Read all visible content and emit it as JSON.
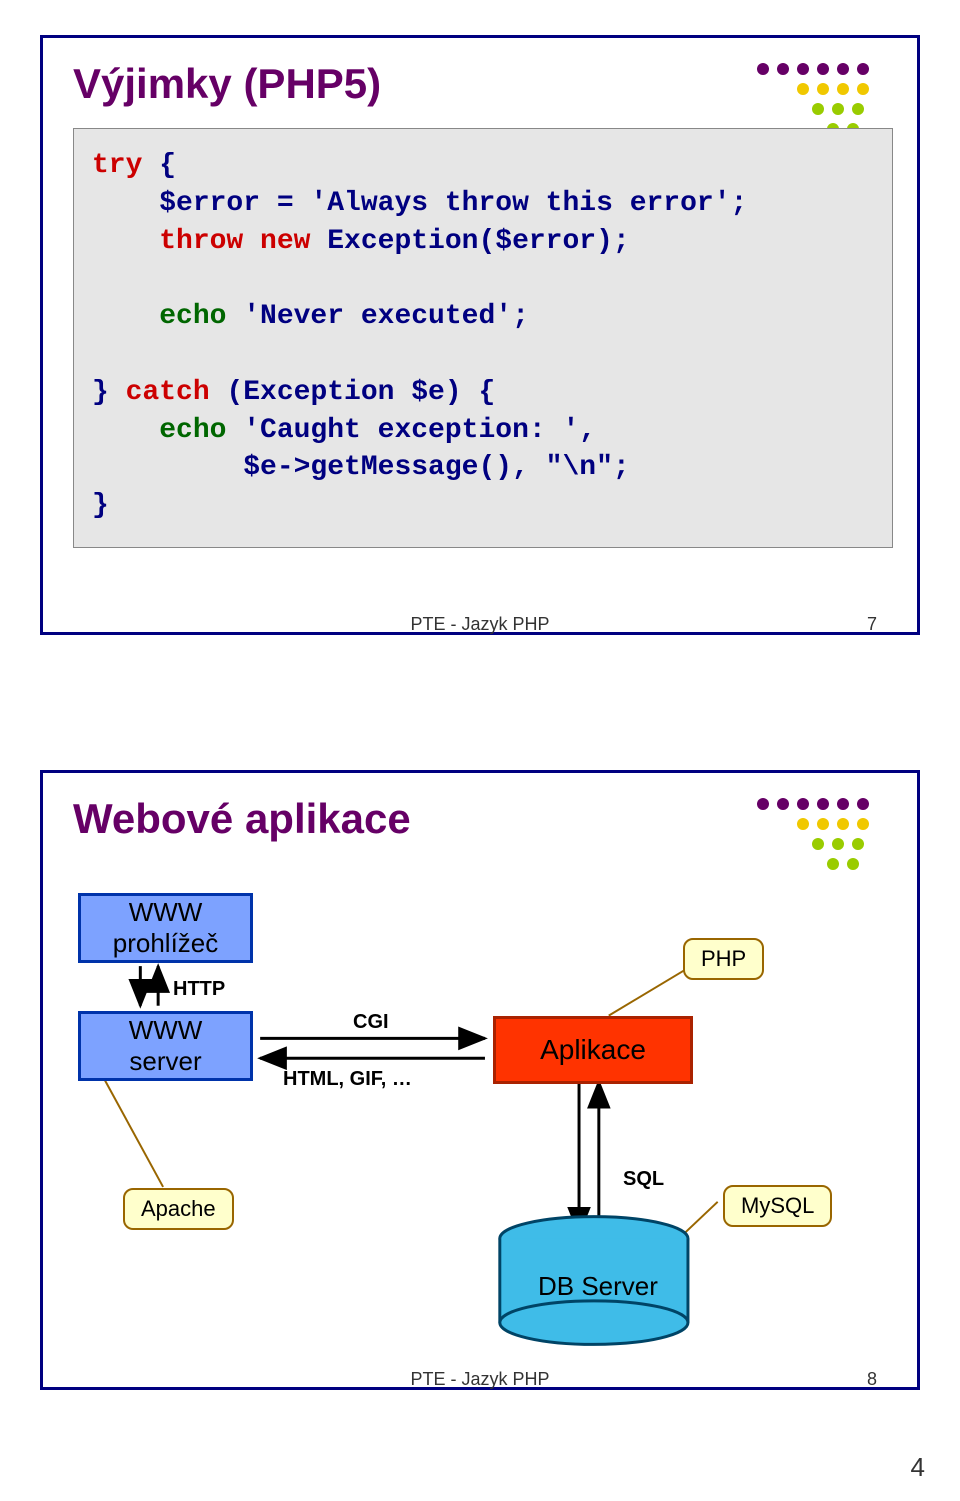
{
  "slide1": {
    "title": "Výjimky (PHP5)",
    "code": {
      "l1a": "try",
      "l1b": " {",
      "l2": "    $error = 'Always throw this error';",
      "l3a": "    throw new",
      "l3b": " Exception($error);",
      "l4": "",
      "l5a": "    echo",
      "l5b": " 'Never executed';",
      "l6": "",
      "l7a": "} ",
      "l7b": "catch",
      "l7c": " (Exception $e) {",
      "l8a": "    echo",
      "l8b": " 'Caught exception: ',",
      "l9": "         $e->getMessage(), \"\\n\";",
      "l10": "}"
    },
    "footer_text": "PTE - Jazyk PHP",
    "page_num": "7"
  },
  "slide2": {
    "title": "Webové aplikace",
    "boxes": {
      "browser": "WWW\nprohlížeč",
      "server": "WWW\nserver",
      "app": "Aplikace",
      "db": "DB Server"
    },
    "labels": {
      "http": "HTTP",
      "cgi": "CGI",
      "html": "HTML, GIF, …",
      "sql": "SQL"
    },
    "callouts": {
      "apache": "Apache",
      "php": "PHP",
      "mysql": "MySQL"
    },
    "footer_text": "PTE - Jazyk PHP",
    "page_num": "8"
  },
  "page_number": "4"
}
